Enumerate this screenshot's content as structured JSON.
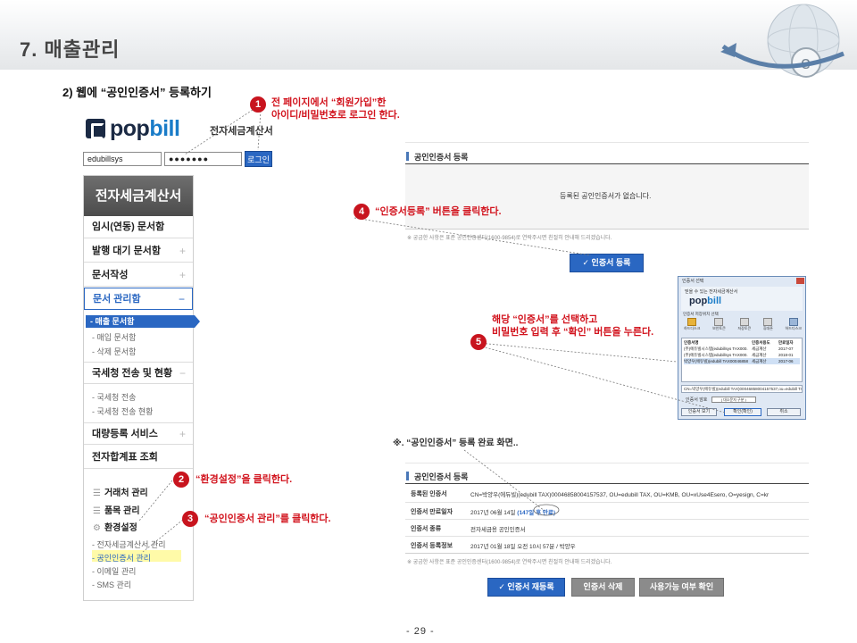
{
  "header": {
    "title": "7. 매출관리"
  },
  "subtitle": "2) 웹에 “공인인증서” 등록하기",
  "callouts": [
    {
      "num": "1",
      "text1": "전 페이지에서 “회원가입”한",
      "text2": "아이디/비밀번호로 로그인 한다."
    },
    {
      "num": "2",
      "text1": "“환경설정”을 클릭한다."
    },
    {
      "num": "3",
      "text1": "“공인인증서 관리”를 클릭한다."
    },
    {
      "num": "4",
      "text1": "“인증서등록” 버튼을 클릭한다."
    },
    {
      "num": "5",
      "text1": "해당 “인증서”를 선택하고",
      "text2": "비밀번호 입력 후 “확인” 버튼을 누른다."
    }
  ],
  "popbill": {
    "logo_prefix": "pop",
    "logo_suffix": "bill",
    "service": "전자세금계산서",
    "id_value": "edubillsys",
    "pw_value": "●●●●●●●",
    "login_label": "로그인"
  },
  "menu": {
    "title": "전자세금계산서",
    "items": [
      {
        "label": "임시(연동) 문서함",
        "icon": ""
      },
      {
        "label": "발행 대기 문서함",
        "icon": "+"
      },
      {
        "label": "문서작성",
        "icon": "+"
      },
      {
        "label": "문서 관리함",
        "icon": "−"
      },
      {
        "label": "국세청 전송 및 현황",
        "icon": "−"
      },
      {
        "label": "대량등록 서비스",
        "icon": "+"
      },
      {
        "label": "전자합계표 조회",
        "icon": ""
      }
    ],
    "doc_sub": [
      "- 매출 문서함",
      "- 매입 문서함",
      "- 삭제 문서함"
    ],
    "nts_sub": [
      "- 국세청 전송",
      "- 국세청 전송 현황"
    ],
    "mgmt": [
      "거래처 관리",
      "품목 관리",
      "환경설정"
    ],
    "settings_sub": [
      "- 전자세금계산서 관리",
      "- 공인인증서 관리",
      "- 이메일 관리",
      "- SMS 관리"
    ]
  },
  "cert_panel": {
    "title": "공인인증서 등록",
    "empty_msg": "등록된 공인인증서가 없습니다.",
    "notice": "※ 궁금한 사항은 표준 공인인증센터(1600-9854)로 연락주시면 친절히 안내해 드리겠습니다.",
    "register_btn": "✓ 인증서 등록"
  },
  "dialog": {
    "caption": "인증서 선택",
    "heading": "믿을 수 있는 전자세금계산서",
    "logo_prefix": "pop",
    "logo_suffix": "bill",
    "location": "인증서 저장위치 선택",
    "icons": [
      "하드디스크",
      "보안토큰",
      "저장토큰",
      "휴대폰",
      "하드디스크"
    ],
    "cols": [
      "인증서명",
      "인증서용도",
      "만료일자"
    ],
    "rows": [
      [
        "(주)에듀빌시스템(edubillsys TAX000...",
        "세금계산",
        "2017-07"
      ],
      [
        "(주)에듀빌시스템(edubillsys TAX000...",
        "세금계산",
        "2018-01"
      ],
      [
        "박양우(에듀빌)(edubill TAX00046858...",
        "세금계산",
        "2017-06"
      ]
    ],
    "field": "CN=박양우(에듀빌)(edubill TAX)00046858004157537,ou=edubill TAX,ou",
    "pw_label": "인증서 암호",
    "pw_hint": "( 대소문자 구분 )",
    "btns": [
      "인증서 보기",
      "확인(확인)",
      "취소"
    ]
  },
  "done_label": "※. “공인인증서” 등록 완료 화면..",
  "done_panel": {
    "title": "공인인증서 등록",
    "rows": [
      {
        "label": "등록된 인증서",
        "value": "CN=박양우(에듀빌)(edubill TAX)00046858004157537, OU=edubill TAX, OU=KMB, OU=xUse4Esero, O=yesign, C=kr"
      },
      {
        "label": "인증서 만료일자",
        "value": "2017년 06월 14일 ",
        "extra": "(147일 후 만료)"
      },
      {
        "label": "인증서 종류",
        "value": "전자세금용 공인인증서"
      },
      {
        "label": "인증서 등록정보",
        "value": "2017년 01월 18일 오전 10시 57분 / 박양우"
      }
    ],
    "notice": "※ 궁금한 사항은 표준 공인인증센터(1600-9854)로 연락주시면 친절히 안내해 드리겠습니다.",
    "btns": [
      "✓ 인증서 재등록",
      "인증서 삭제",
      "사용가능 여부 확인"
    ]
  },
  "page_number": "- 29 -"
}
